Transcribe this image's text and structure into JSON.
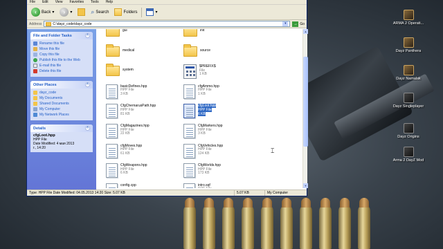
{
  "window": {
    "menu": [
      "File",
      "Edit",
      "View",
      "Favorites",
      "Tools",
      "Help"
    ],
    "toolbar": {
      "back_label": "Back",
      "search_label": "Search",
      "folders_label": "Folders"
    },
    "address": {
      "label": "Address",
      "path": "C:\\dayz_code\\dayz_code",
      "go_label": "Go"
    },
    "tasks": {
      "file_folder_title": "File and Folder Tasks",
      "file_folder_items": [
        "Rename this file",
        "Move this file",
        "Copy this file",
        "Publish this file to the Web",
        "E-mail this file",
        "Delete this file"
      ],
      "other_places_title": "Other Places",
      "other_places_items": [
        "dayz_code",
        "My Documents",
        "Shared Documents",
        "My Computer",
        "My Network Places"
      ],
      "details_title": "Details",
      "details": {
        "name": "cfgLoot.hpp",
        "type": "HPP File",
        "date_label": "Date Modified: 4 мая 2013",
        "date_cont": "г., 14:20",
        "size": "Size: 5.07 KB"
      }
    },
    "files": [
      {
        "name": "gui",
        "sub1": "",
        "sub2": "",
        "icon": "folder"
      },
      {
        "name": "init",
        "sub1": "",
        "sub2": "",
        "icon": "folder"
      },
      {
        "name": "medical",
        "sub1": "",
        "sub2": "",
        "icon": "folder"
      },
      {
        "name": "source",
        "sub1": "",
        "sub2": "",
        "icon": "folder"
      },
      {
        "name": "system",
        "sub1": "",
        "sub2": "",
        "icon": "folder"
      },
      {
        "name": "$PREFIX$",
        "sub1": "File",
        "sub2": "1 KB",
        "icon": "app"
      },
      {
        "name": "basicDefines.hpp",
        "sub1": "HPP File",
        "sub2": "3 KB",
        "icon": "file"
      },
      {
        "name": "cfgAmmo.hpp",
        "sub1": "HPP File",
        "sub2": "1 KB",
        "icon": "file"
      },
      {
        "name": "CfgChernarusPath.hpp",
        "sub1": "HPP File",
        "sub2": "81 KB",
        "icon": "file"
      },
      {
        "name": "cfgLoot.hpp",
        "sub1": "HPP File",
        "sub2": "6 KB",
        "icon": "file",
        "selected": true
      },
      {
        "name": "CfgMagazines.hpp",
        "sub1": "HPP File",
        "sub2": "22 KB",
        "icon": "file"
      },
      {
        "name": "CfgMarkers.hpp",
        "sub1": "HPP File",
        "sub2": "3 KB",
        "icon": "file"
      },
      {
        "name": "cfgMoves.hpp",
        "sub1": "HPP File",
        "sub2": "61 KB",
        "icon": "file"
      },
      {
        "name": "CfgVehicles.hpp",
        "sub1": "HPP File",
        "sub2": "124 KB",
        "icon": "file"
      },
      {
        "name": "CfgWeapons.hpp",
        "sub1": "HPP File",
        "sub2": "6 KB",
        "icon": "file"
      },
      {
        "name": "CfgWorlds.hpp",
        "sub1": "HPP File",
        "sub2": "173 KB",
        "icon": "file"
      },
      {
        "name": "config.cpp",
        "sub1": "",
        "sub2": "",
        "icon": "file"
      },
      {
        "name": "intro.sqf",
        "sub1": "SQF File",
        "sub2": "",
        "icon": "file"
      }
    ],
    "status": {
      "info": "Type: HPP File Date Modified: 04.05.2013 14:20 Size: 5.07 KB",
      "size": "5.07 KB",
      "location": "My Computer"
    }
  },
  "desktop": {
    "icons": [
      "ARMA 2 Operati...",
      "Dayz Panthera",
      "Dayz Namalsk",
      "Dayz Singleplayer",
      "Dayz Origins",
      "Arma 2 DayZ Mod"
    ]
  }
}
